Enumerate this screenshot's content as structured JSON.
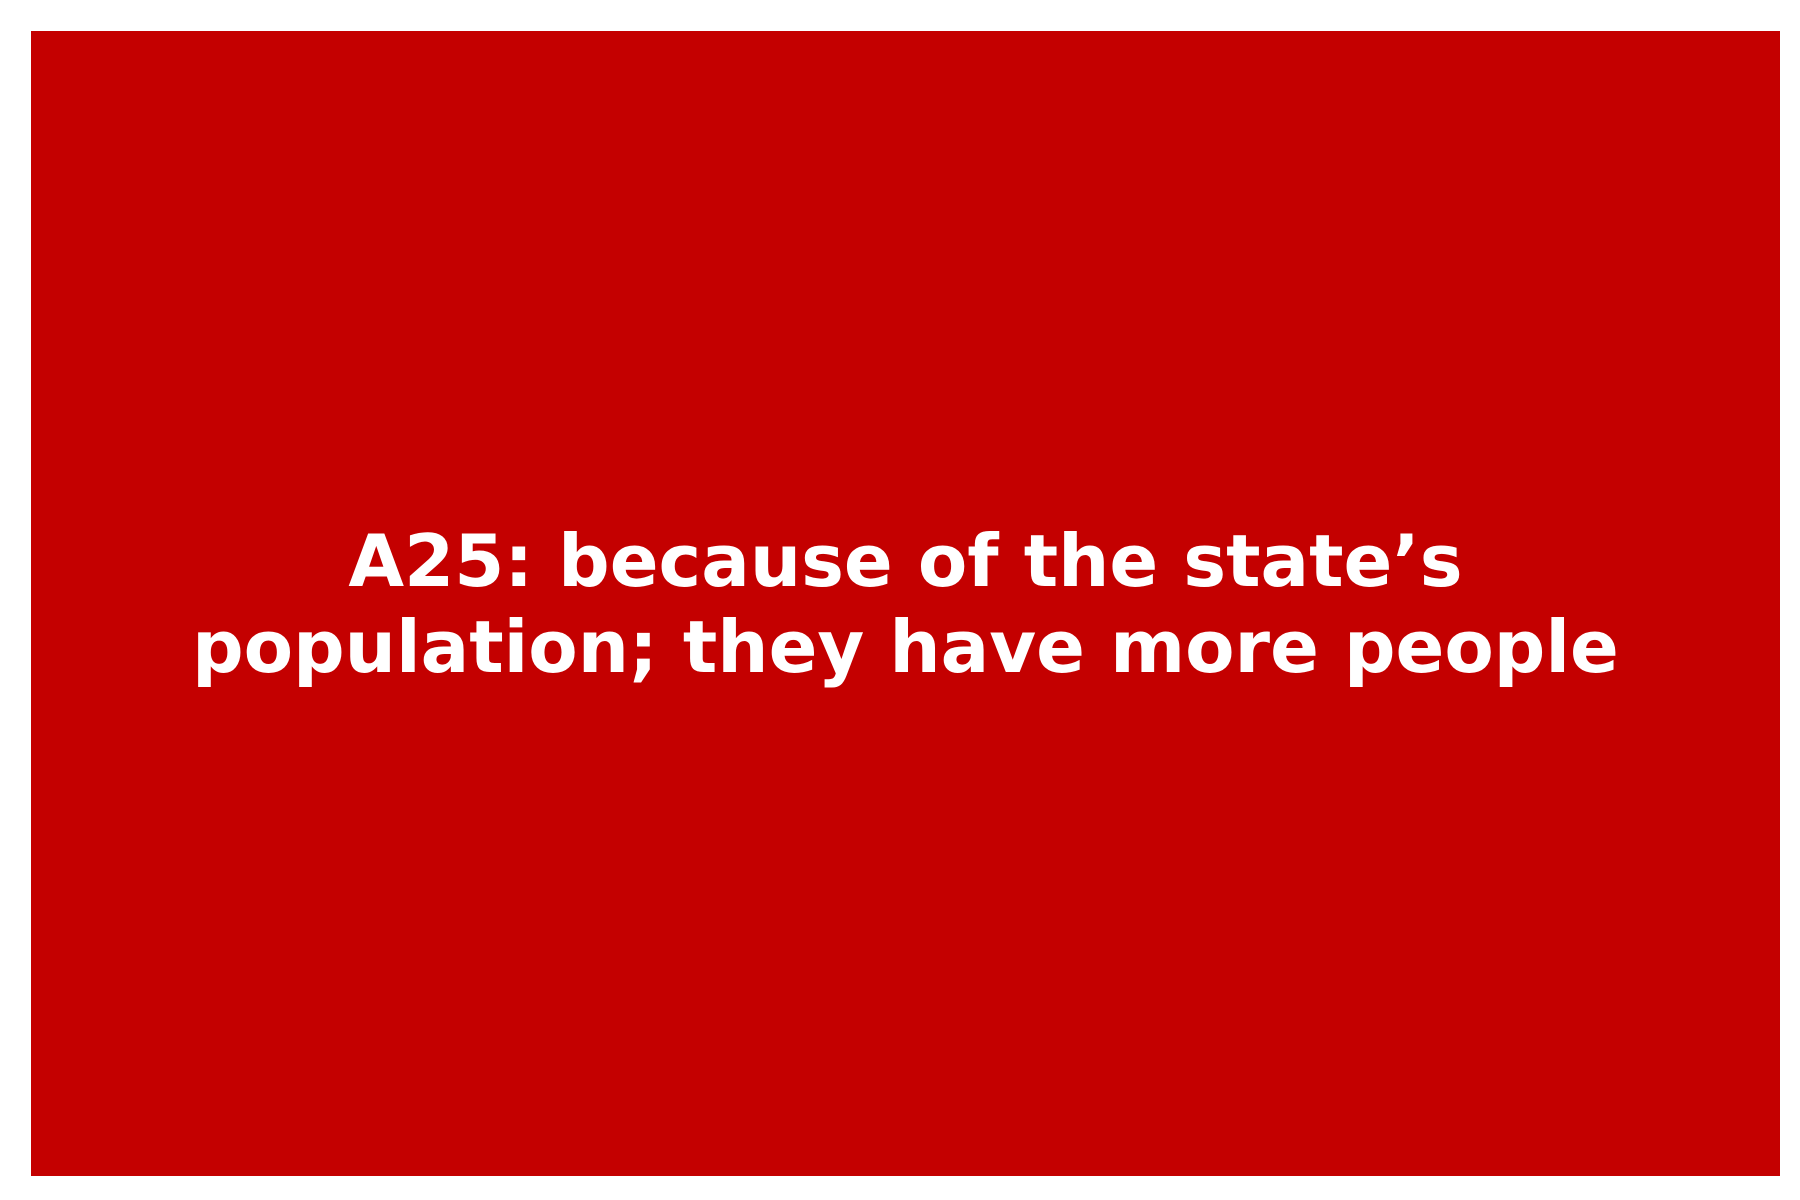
{
  "card": {
    "background_color": "#c40000",
    "text_color": "#ffffff",
    "lines": [
      "A25: because of the state’s",
      "population; they have more people"
    ]
  }
}
